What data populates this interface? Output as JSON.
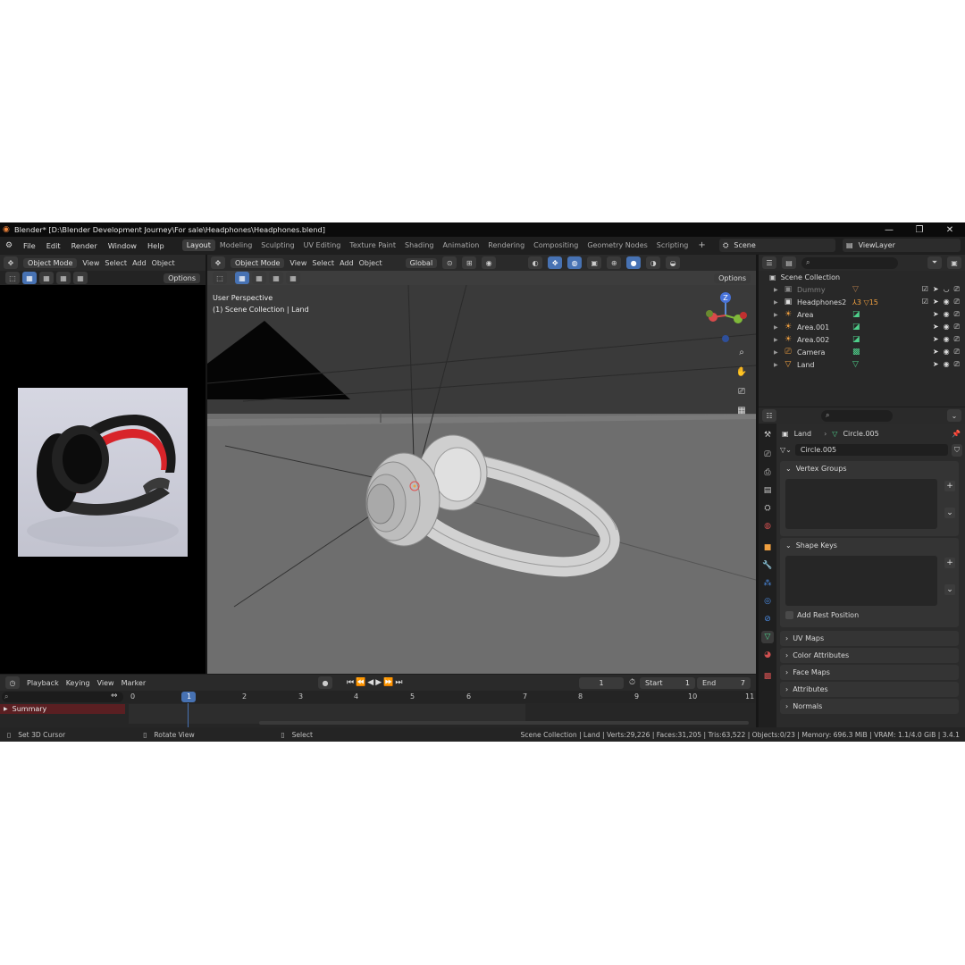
{
  "window": {
    "title": "Blender* [D:\\Blender Development Journey\\For sale\\Headphones\\Headphones.blend]",
    "minimize": "—",
    "maximize": "❐",
    "close": "✕"
  },
  "menu": {
    "items": [
      "File",
      "Edit",
      "Render",
      "Window",
      "Help"
    ],
    "workspaces": [
      "Layout",
      "Modeling",
      "Sculpting",
      "UV Editing",
      "Texture Paint",
      "Shading",
      "Animation",
      "Rendering",
      "Compositing",
      "Geometry Nodes",
      "Scripting"
    ],
    "active_workspace": "Layout",
    "add_workspace": "+",
    "scene": "Scene",
    "view_layer": "ViewLayer"
  },
  "image_editor": {
    "mode": "Object Mode",
    "menus": [
      "View",
      "Select",
      "Add",
      "Object"
    ],
    "options": "Options"
  },
  "viewport": {
    "mode": "Object Mode",
    "menus": [
      "View",
      "Select",
      "Add",
      "Object"
    ],
    "transform_orientation": "Global",
    "options": "Options",
    "info_line1": "User Perspective",
    "info_line2": "(1) Scene Collection | Land",
    "gizmo_z": "Z"
  },
  "outliner": {
    "search_placeholder": "",
    "root": "Scene Collection",
    "rows": [
      {
        "name": "Dummy",
        "dim": true
      },
      {
        "name": "Headphones2",
        "dim": false,
        "badge1": "3",
        "badge2": "15"
      },
      {
        "name": "Area",
        "dim": false
      },
      {
        "name": "Area.001",
        "dim": false
      },
      {
        "name": "Area.002",
        "dim": false
      },
      {
        "name": "Camera",
        "dim": false
      },
      {
        "name": "Land",
        "dim": false
      }
    ]
  },
  "properties": {
    "breadcrumb_object": "Land",
    "breadcrumb_data": "Circle.005",
    "datablock_name": "Circle.005",
    "panels": {
      "vertex_groups": "Vertex Groups",
      "shape_keys": "Shape Keys",
      "add_rest_position": "Add Rest Position",
      "uv_maps": "UV Maps",
      "color_attributes": "Color Attributes",
      "face_maps": "Face Maps",
      "attributes": "Attributes",
      "normals": "Normals"
    }
  },
  "timeline": {
    "menus": [
      "Playback",
      "Keying",
      "View",
      "Marker"
    ],
    "current_frame": "1",
    "start_label": "Start",
    "start_value": "1",
    "end_label": "End",
    "end_value": "7",
    "frames": [
      "0",
      "1",
      "2",
      "3",
      "4",
      "5",
      "6",
      "7",
      "8",
      "9",
      "10",
      "11"
    ],
    "summary": "Summary"
  },
  "statusbar": {
    "hint1": "Set 3D Cursor",
    "hint2": "Rotate View",
    "hint3": "Select",
    "stats": "Scene Collection | Land | Verts:29,226 | Faces:31,205 | Tris:63,522 | Objects:0/23 | Memory: 696.3 MiB | VRAM: 1.1/4.0 GiB | 3.4.1"
  },
  "colors": {
    "accent": "#4772b3",
    "frame_cursor": "#4772b3",
    "summary_bar": "#5a1f22",
    "mesh_data": "#4ecf8a",
    "light_object": "#f0a040"
  }
}
